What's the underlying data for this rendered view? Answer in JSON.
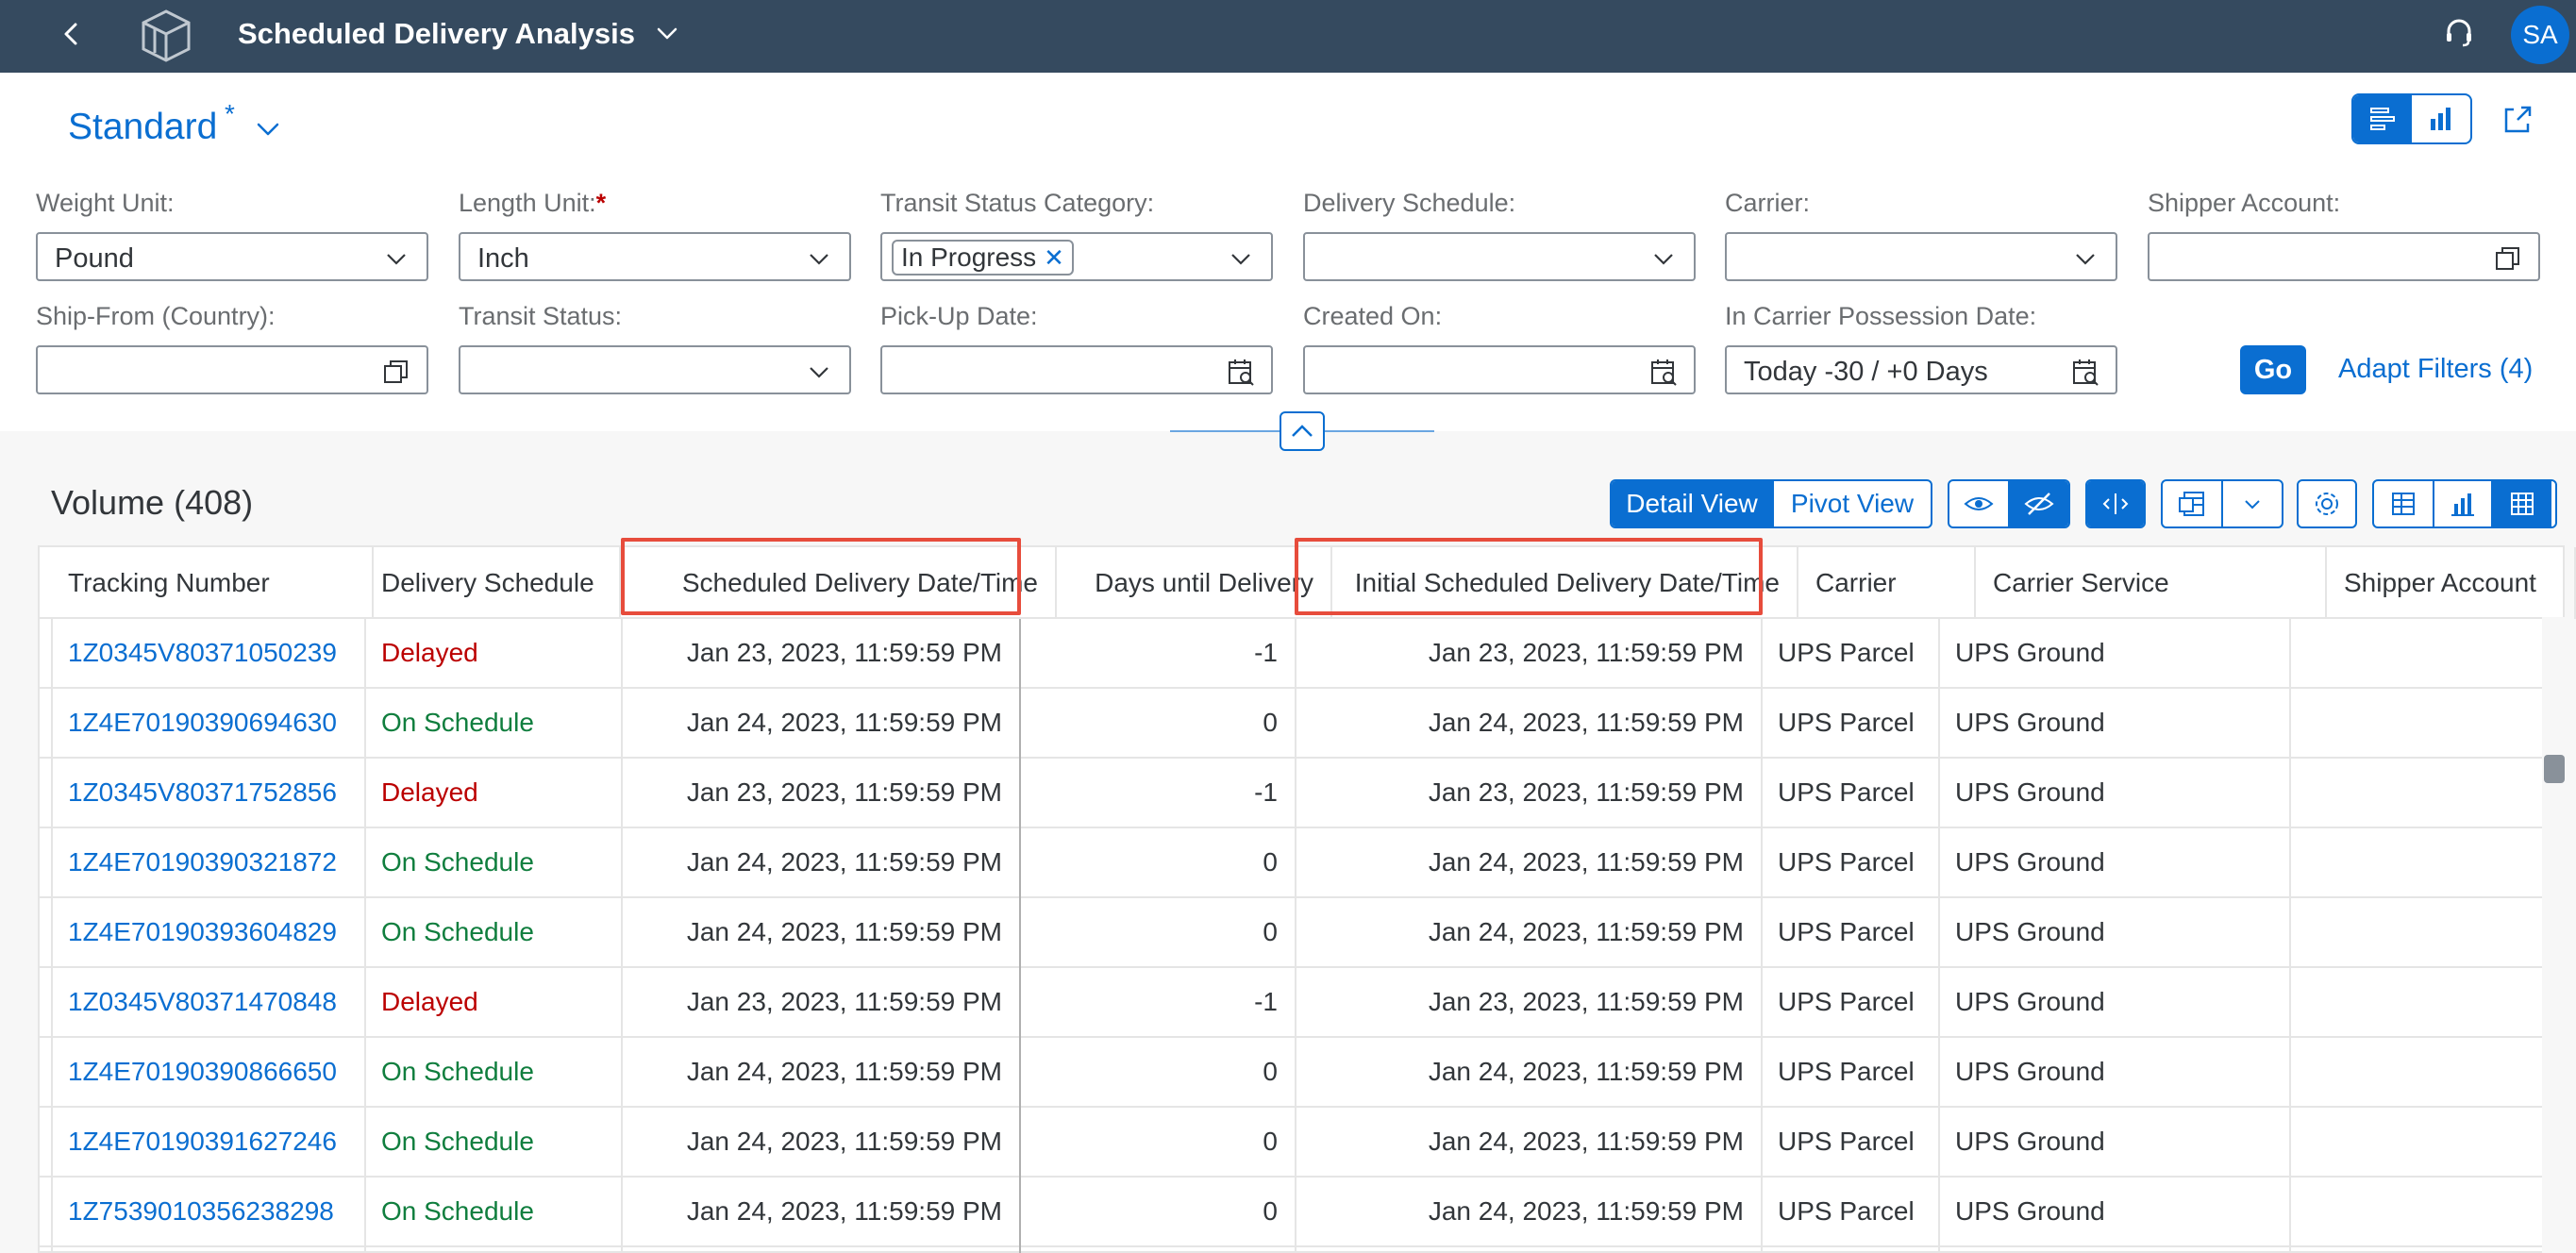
{
  "shell": {
    "title": "Scheduled Delivery Analysis",
    "avatar_initials": "SA"
  },
  "header": {
    "variant_name": "Standard",
    "variant_modified_marker": "*"
  },
  "filters": {
    "weight_unit": {
      "label": "Weight Unit:",
      "value": "Pound"
    },
    "length_unit": {
      "label": "Length Unit:",
      "required_marker": "*",
      "value": "Inch"
    },
    "transit_status_category": {
      "label": "Transit Status Category:",
      "token": "In Progress"
    },
    "delivery_schedule": {
      "label": "Delivery Schedule:",
      "value": ""
    },
    "carrier": {
      "label": "Carrier:",
      "value": ""
    },
    "shipper_account": {
      "label": "Shipper Account:",
      "value": ""
    },
    "ship_from_country": {
      "label": "Ship-From (Country):",
      "value": ""
    },
    "transit_status": {
      "label": "Transit Status:",
      "value": ""
    },
    "pickup_date": {
      "label": "Pick-Up Date:",
      "value": ""
    },
    "created_on": {
      "label": "Created On:",
      "value": ""
    },
    "in_carrier_possession_date": {
      "label": "In Carrier Possession Date:",
      "value": "Today -30 / +0 Days"
    },
    "go_label": "Go",
    "adapt_filters_label": "Adapt Filters (4)"
  },
  "table": {
    "title": "Volume (408)",
    "view_toggle": {
      "detail": "Detail View",
      "pivot": "Pivot View"
    },
    "columns": [
      "Tracking Number",
      "Delivery Schedule",
      "Scheduled Delivery Date/Time",
      "Days until Delivery",
      "Initial Scheduled Delivery Date/Time",
      "Carrier",
      "Carrier Service",
      "Shipper Account"
    ],
    "rows": [
      {
        "tracking": "1Z0345V80371050239",
        "schedule": "Delayed",
        "sched_dt": "Jan 23, 2023, 11:59:59 PM",
        "days": "-1",
        "initial_dt": "Jan 23, 2023, 11:59:59 PM",
        "carrier": "UPS Parcel",
        "service": "UPS Ground",
        "shipper": ""
      },
      {
        "tracking": "1Z4E70190390694630",
        "schedule": "On Schedule",
        "sched_dt": "Jan 24, 2023, 11:59:59 PM",
        "days": "0",
        "initial_dt": "Jan 24, 2023, 11:59:59 PM",
        "carrier": "UPS Parcel",
        "service": "UPS Ground",
        "shipper": ""
      },
      {
        "tracking": "1Z0345V80371752856",
        "schedule": "Delayed",
        "sched_dt": "Jan 23, 2023, 11:59:59 PM",
        "days": "-1",
        "initial_dt": "Jan 23, 2023, 11:59:59 PM",
        "carrier": "UPS Parcel",
        "service": "UPS Ground",
        "shipper": ""
      },
      {
        "tracking": "1Z4E70190390321872",
        "schedule": "On Schedule",
        "sched_dt": "Jan 24, 2023, 11:59:59 PM",
        "days": "0",
        "initial_dt": "Jan 24, 2023, 11:59:59 PM",
        "carrier": "UPS Parcel",
        "service": "UPS Ground",
        "shipper": ""
      },
      {
        "tracking": "1Z4E70190393604829",
        "schedule": "On Schedule",
        "sched_dt": "Jan 24, 2023, 11:59:59 PM",
        "days": "0",
        "initial_dt": "Jan 24, 2023, 11:59:59 PM",
        "carrier": "UPS Parcel",
        "service": "UPS Ground",
        "shipper": ""
      },
      {
        "tracking": "1Z0345V80371470848",
        "schedule": "Delayed",
        "sched_dt": "Jan 23, 2023, 11:59:59 PM",
        "days": "-1",
        "initial_dt": "Jan 23, 2023, 11:59:59 PM",
        "carrier": "UPS Parcel",
        "service": "UPS Ground",
        "shipper": ""
      },
      {
        "tracking": "1Z4E70190390866650",
        "schedule": "On Schedule",
        "sched_dt": "Jan 24, 2023, 11:59:59 PM",
        "days": "0",
        "initial_dt": "Jan 24, 2023, 11:59:59 PM",
        "carrier": "UPS Parcel",
        "service": "UPS Ground",
        "shipper": ""
      },
      {
        "tracking": "1Z4E70190391627246",
        "schedule": "On Schedule",
        "sched_dt": "Jan 24, 2023, 11:59:59 PM",
        "days": "0",
        "initial_dt": "Jan 24, 2023, 11:59:59 PM",
        "carrier": "UPS Parcel",
        "service": "UPS Ground",
        "shipper": ""
      },
      {
        "tracking": "1Z7539010356238298",
        "schedule": "On Schedule",
        "sched_dt": "Jan 24, 2023, 11:59:59 PM",
        "days": "0",
        "initial_dt": "Jan 24, 2023, 11:59:59 PM",
        "carrier": "UPS Parcel",
        "service": "UPS Ground",
        "shipper": ""
      }
    ]
  },
  "icons": {
    "back": "chevron-left-icon",
    "logo": "cube-logo-icon",
    "help": "headset-icon",
    "dropdown": "chevron-down-icon",
    "value_help": "value-help-icon",
    "calendar": "calendar-icon",
    "share": "share-icon"
  },
  "colors": {
    "shell": "#354a5f",
    "accent": "#0a6ed1",
    "delayed": "#bb0000",
    "on_schedule": "#107e3e",
    "highlight": "#e74c3c"
  }
}
